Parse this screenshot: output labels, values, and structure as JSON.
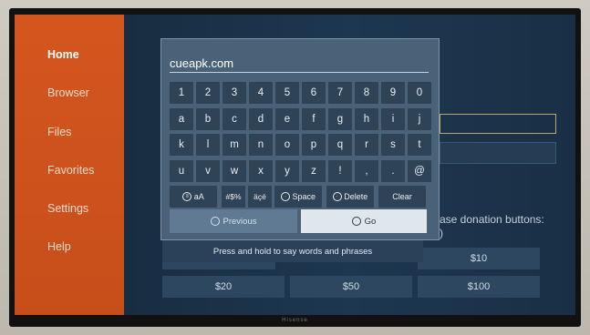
{
  "sidebar": {
    "items": [
      {
        "label": "Home"
      },
      {
        "label": "Browser"
      },
      {
        "label": "Files"
      },
      {
        "label": "Favorites"
      },
      {
        "label": "Settings"
      },
      {
        "label": "Help"
      }
    ]
  },
  "keyboard": {
    "input_value": "cueapk.com",
    "rows": [
      [
        "1",
        "2",
        "3",
        "4",
        "5",
        "6",
        "7",
        "8",
        "9",
        "0"
      ],
      [
        "a",
        "b",
        "c",
        "d",
        "e",
        "f",
        "g",
        "h",
        "i",
        "j"
      ],
      [
        "k",
        "l",
        "m",
        "n",
        "o",
        "p",
        "q",
        "r",
        "s",
        "t"
      ],
      [
        "u",
        "v",
        "w",
        "x",
        "y",
        "z",
        "!",
        ",",
        ".",
        "@"
      ]
    ],
    "function_keys": {
      "case": "aA",
      "symbols": "#$%",
      "accents": "äçé",
      "space": "Space",
      "delete": "Delete",
      "clear": "Clear"
    },
    "previous_label": "Previous",
    "go_label": "Go",
    "hint": "Press and hold to say words and phrases"
  },
  "donations": {
    "note": "ase donation buttons:",
    "note_line2": ")",
    "amounts": [
      "$10",
      "$20",
      "$50",
      "$100"
    ]
  },
  "tv_brand": "Hisense"
}
